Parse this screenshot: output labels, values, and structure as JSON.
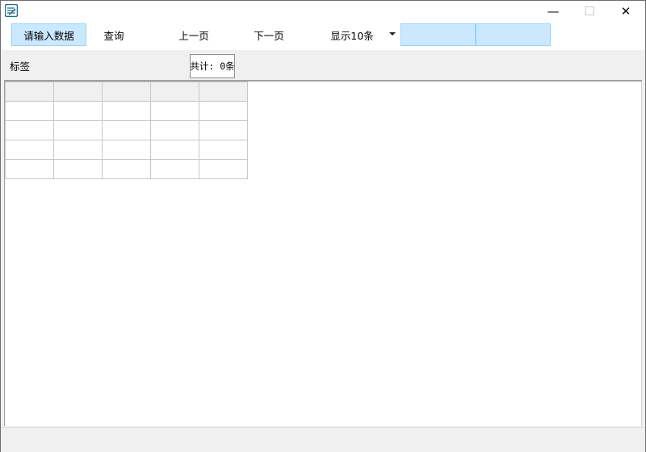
{
  "window": {
    "minimize_glyph": "—",
    "maximize_glyph": "☐",
    "close_glyph": "✕"
  },
  "toolbar": {
    "input_prompt": "请输入数据",
    "query_label": "查询",
    "prev_page_label": "上一页",
    "next_page_label": "下一页",
    "page_size_label": "显示10条"
  },
  "label_area": {
    "label": "标签",
    "total_count": "共计: 0条"
  },
  "grid": {
    "columns": [
      "",
      "",
      "",
      "",
      ""
    ],
    "rows": [
      [
        "",
        "",
        "",
        "",
        ""
      ],
      [
        "",
        "",
        "",
        "",
        ""
      ],
      [
        "",
        "",
        "",
        "",
        ""
      ],
      [
        "",
        "",
        "",
        "",
        ""
      ]
    ]
  },
  "colors": {
    "selection_fill": "#cce8ff",
    "selection_border": "#99d1ff",
    "app_icon": "#1f6f8b"
  }
}
